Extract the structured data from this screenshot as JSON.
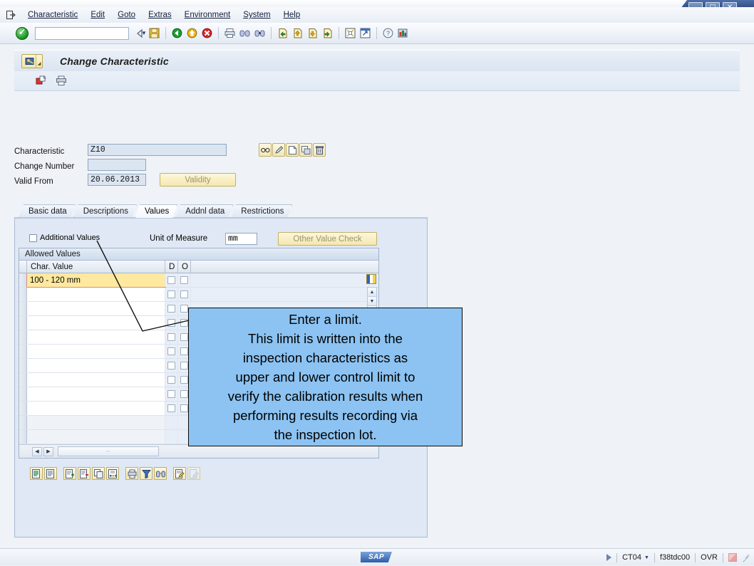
{
  "window": {
    "minimize_label": "–",
    "maximize_label": "□",
    "close_label": "✕"
  },
  "menubar": {
    "system_icon": "system-menu-icon",
    "items": [
      {
        "label": "Characteristic",
        "accel": "C"
      },
      {
        "label": "Edit",
        "accel": "E"
      },
      {
        "label": "Goto",
        "accel": "G"
      },
      {
        "label": "Extras",
        "accel": "a"
      },
      {
        "label": "Environment",
        "accel": "v"
      },
      {
        "label": "System",
        "accel": "y"
      },
      {
        "label": "Help",
        "accel": "H"
      }
    ]
  },
  "toolbar": {
    "enter_icon": "green-check-enter-icon",
    "command_field_value": "",
    "command_field_placeholder": "",
    "dropdown_icon": "chevron-down-icon",
    "icons": [
      "back-arrow-icon",
      "save-disk-icon",
      "back-green-icon",
      "exit-yellow-icon",
      "cancel-red-icon",
      "print-icon",
      "find-icon",
      "find-next-icon",
      "first-page-icon",
      "previous-page-icon",
      "next-page-icon",
      "last-page-icon",
      "create-session-icon",
      "create-shortcut-icon",
      "help-icon",
      "customize-local-layout-icon"
    ]
  },
  "screen": {
    "title": "Change Characteristic",
    "back_button_icon": "menu-object-icon",
    "back_button_caret": "◢",
    "app_toolbar_icons": [
      "new-entry-icon",
      "print-preview-icon"
    ]
  },
  "form": {
    "characteristic_label": "Characteristic",
    "characteristic_value": "Z10",
    "change_number_label": "Change Number",
    "change_number_value": "",
    "valid_from_label": "Valid From",
    "valid_from_value": "20.06.2013",
    "validity_button_label": "Validity",
    "object_icons": [
      "display-glasses-icon",
      "edit-pencil-icon",
      "create-page-icon",
      "copy-icon",
      "delete-trash-icon"
    ]
  },
  "tabs": [
    {
      "label": "Basic data",
      "active": false
    },
    {
      "label": "Descriptions",
      "active": false
    },
    {
      "label": "Values",
      "active": true
    },
    {
      "label": "Addnl data",
      "active": false
    },
    {
      "label": "Restrictions",
      "active": false
    }
  ],
  "values_tab": {
    "additional_values_label": "Additional Values",
    "additional_values_checked": false,
    "unit_of_measure_label": "Unit of Measure",
    "unit_of_measure_value": "mm",
    "other_value_check_label": "Other Value Check",
    "grid_caption": "Allowed Values",
    "columns": [
      {
        "key": "char_value",
        "label": "Char. Value"
      },
      {
        "key": "d",
        "label": "D"
      },
      {
        "key": "o",
        "label": "O"
      }
    ],
    "rows": [
      {
        "char_value": "100 - 120 mm",
        "d": false,
        "o": false,
        "selected": true,
        "has_checks": true
      },
      {
        "char_value": "",
        "d": false,
        "o": false,
        "selected": false,
        "has_checks": true
      },
      {
        "char_value": "",
        "d": false,
        "o": false,
        "selected": false,
        "has_checks": true
      },
      {
        "char_value": "",
        "d": false,
        "o": false,
        "selected": false,
        "has_checks": true
      },
      {
        "char_value": "",
        "d": false,
        "o": false,
        "selected": false,
        "has_checks": true
      },
      {
        "char_value": "",
        "d": false,
        "o": false,
        "selected": false,
        "has_checks": true
      },
      {
        "char_value": "",
        "d": false,
        "o": false,
        "selected": false,
        "has_checks": true
      },
      {
        "char_value": "",
        "d": false,
        "o": false,
        "selected": false,
        "has_checks": true
      },
      {
        "char_value": "",
        "d": false,
        "o": false,
        "selected": false,
        "has_checks": true
      },
      {
        "char_value": "",
        "d": false,
        "o": false,
        "selected": false,
        "has_checks": true
      },
      {
        "char_value": "",
        "d": false,
        "o": false,
        "selected": false,
        "has_checks": false
      },
      {
        "char_value": "",
        "d": false,
        "o": false,
        "selected": false,
        "has_checks": false
      }
    ],
    "grid_config_icon": "column-config-icon",
    "scroll_up_icon": "▲",
    "scroll_down_icon": "▼",
    "hscroll_left_icon": "◀",
    "hscroll_right_icon": "▶",
    "hscroll_grip": "⋯",
    "bottom_icons": [
      "display-list-icon",
      "detail-list-icon",
      "insert-row-icon",
      "delete-row-icon",
      "copy-row-icon",
      "sort-reorder-icon",
      "print-list-icon",
      "filter-icon",
      "find-binoculars-icon",
      "edit-note-icon",
      "edit-disabled-icon"
    ]
  },
  "annotation": {
    "lines": [
      "Enter a limit.",
      "This limit is written into the",
      "inspection characteristics as",
      "upper and lower control limit to",
      "verify the calibration results when",
      "performing results recording via",
      "the inspection lot."
    ],
    "background_color": "#8cc3f2",
    "border_color": "#000000"
  },
  "statusbar": {
    "logo_text": "SAP",
    "indicator_icon": "status-triangle-icon",
    "transaction_code": "CT04",
    "transaction_caret": "▼",
    "server": "f38tdc00",
    "insert_mode": "OVR",
    "connection_icon": "connection-status-icon",
    "resize_grip_icon": "resize-grip-icon"
  }
}
